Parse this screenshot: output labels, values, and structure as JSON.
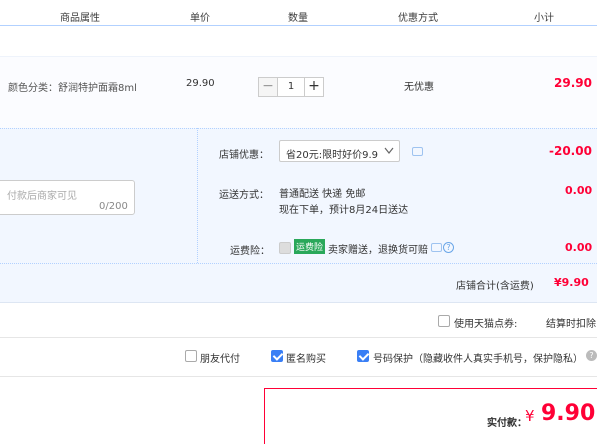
{
  "header": {
    "col_attr": "商品属性",
    "col_price": "单价",
    "col_qty": "数量",
    "col_discount": "优惠方式",
    "col_subtotal": "小计"
  },
  "item": {
    "attr": "颜色分类：舒润特护面霜8ml",
    "price": "29.90",
    "qty_minus": "−",
    "qty_value": "1",
    "qty_plus": "+",
    "discount": "无优惠",
    "subtotal": "29.90"
  },
  "message": {
    "placeholder": "付款后商家可见",
    "count": "0/200"
  },
  "shop_discount": {
    "label": "店铺优惠：",
    "selected": "省20元:限时好价9.9",
    "amount": "-20.00"
  },
  "shipping": {
    "label": "运送方式：",
    "method": "普通配送 快递 免邮",
    "eta": "现在下单，预计8月24日送达",
    "amount": "0.00"
  },
  "insurance": {
    "label": "运费险：",
    "badge": "运费险",
    "text": "卖家赠送，退换货可赔",
    "amount": "0.00"
  },
  "shop_total": {
    "label": "店铺合计(含运费)",
    "amount": "¥9.90"
  },
  "points": {
    "label": "使用天猫点券:",
    "note": "结算时扣除"
  },
  "options": {
    "friend_pay": "朋友代付",
    "anonymous": "匿名购买",
    "privacy": "号码保护（隐藏收件人真实手机号，保护隐私）"
  },
  "payment": {
    "label": "实付款：",
    "currency": "¥",
    "amount": "9.90"
  },
  "colors": {
    "accent_red": "#ff0036",
    "accent_blue": "#3a7ff5",
    "panel_blue": "#f2f7ff",
    "badge_green": "#2aa85a"
  }
}
